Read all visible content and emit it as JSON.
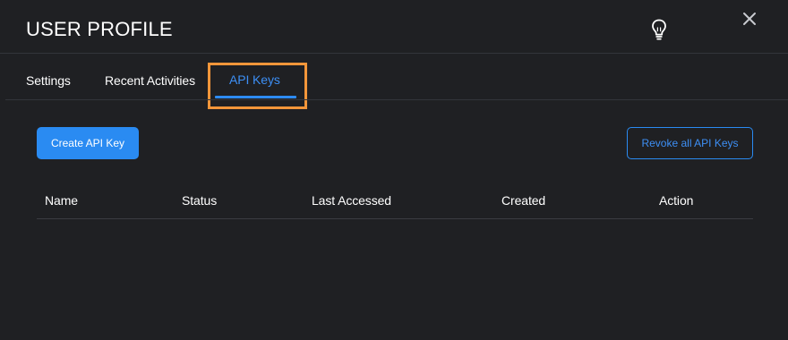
{
  "header": {
    "title": "USER PROFILE",
    "hint_icon": "lightbulb-icon",
    "close_icon": "close-icon"
  },
  "tabs": [
    {
      "label": "Settings",
      "active": false
    },
    {
      "label": "Recent Activities",
      "active": false
    },
    {
      "label": "API Keys",
      "active": true
    }
  ],
  "actions": {
    "create_label": "Create API Key",
    "revoke_label": "Revoke all API Keys"
  },
  "table": {
    "columns": [
      "Name",
      "Status",
      "Last Accessed",
      "Created",
      "Action"
    ],
    "rows": []
  },
  "colors": {
    "background": "#1f2023",
    "accent": "#2a8bf2",
    "highlight": "#f3963a"
  }
}
